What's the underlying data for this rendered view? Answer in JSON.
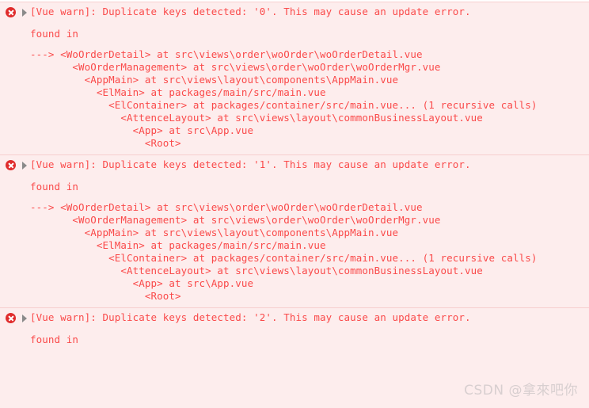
{
  "console": {
    "background_color": "#fdeded",
    "text_color": "#fa4a4a",
    "divider_color": "#f7cfcf",
    "error_icon_color": "#e02c2c",
    "disclosure_icon_color": "#8a8a8a",
    "icons": {
      "error": "error-circle-x-icon",
      "disclosure": "disclosure-triangle-right-icon"
    },
    "messages": [
      {
        "icon": "error-circle-x-icon",
        "disclosure": "disclosure-triangle-right-icon",
        "summary": "[Vue warn]: Duplicate keys detected: '0'. This may cause an update error.",
        "found_in_label": "found in",
        "trace": [
          "---> <WoOrderDetail> at src\\views\\order\\woOrder\\woOrderDetail.vue",
          "       <WoOrderManagement> at src\\views\\order\\woOrder\\woOrderMgr.vue",
          "         <AppMain> at src\\views\\layout\\components\\AppMain.vue",
          "           <ElMain> at packages/main/src/main.vue",
          "             <ElContainer> at packages/container/src/main.vue... (1 recursive calls)",
          "               <AttenceLayout> at src\\views\\layout\\commonBusinessLayout.vue",
          "                 <App> at src\\App.vue",
          "                   <Root>"
        ]
      },
      {
        "icon": "error-circle-x-icon",
        "disclosure": "disclosure-triangle-right-icon",
        "summary": "[Vue warn]: Duplicate keys detected: '1'. This may cause an update error.",
        "found_in_label": "found in",
        "trace": [
          "---> <WoOrderDetail> at src\\views\\order\\woOrder\\woOrderDetail.vue",
          "       <WoOrderManagement> at src\\views\\order\\woOrder\\woOrderMgr.vue",
          "         <AppMain> at src\\views\\layout\\components\\AppMain.vue",
          "           <ElMain> at packages/main/src/main.vue",
          "             <ElContainer> at packages/container/src/main.vue... (1 recursive calls)",
          "               <AttenceLayout> at src\\views\\layout\\commonBusinessLayout.vue",
          "                 <App> at src\\App.vue",
          "                   <Root>"
        ]
      },
      {
        "icon": "error-circle-x-icon",
        "disclosure": "disclosure-triangle-right-icon",
        "summary": "[Vue warn]: Duplicate keys detected: '2'. This may cause an update error.",
        "found_in_label": "found in",
        "trace": []
      }
    ],
    "watermark": "CSDN @拿來吧你"
  }
}
